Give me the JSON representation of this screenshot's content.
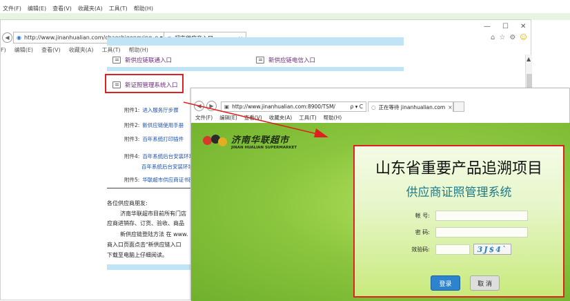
{
  "back_window": {
    "menu": [
      "文件(F)",
      "编辑(E)",
      "查看(V)",
      "收藏夹(A)",
      "工具(T)",
      "帮助(H)"
    ]
  },
  "window1": {
    "url": "http://www.jinanhualian.com/chaoshigongying",
    "addr_controls": "ρ ▾ C",
    "tab_title": "超市供应商入口",
    "tab_close": "×",
    "window_controls": [
      "—",
      "☐",
      "✕"
    ],
    "menu": [
      "F)",
      "编辑(E)",
      "查看(V)",
      "收藏夹(A)",
      "工具(T)",
      "帮助(H)"
    ],
    "links": {
      "unicom": "新供应链联通入口",
      "telecom": "新供应链电信入口",
      "license": "新证照管理系统入口"
    },
    "attachments": [
      {
        "label": "附件1:",
        "text": "进入服务厅步骤"
      },
      {
        "label": "附件2:",
        "text": "新供应链使用手册"
      },
      {
        "label": "附件3:",
        "text": "百年系统打印插件"
      },
      {
        "label": "附件4:",
        "text": "百年系统后台安装环境"
      },
      {
        "label": "",
        "text": "百年系统后台安装环境"
      },
      {
        "label": "附件5:",
        "text": "华联超市供应商证书图"
      }
    ],
    "paragraphs": [
      "各位供应商朋友:",
      "济南华联超市目前所有门店",
      "应商进销存、订货、验收、商品",
      "新供应链登陆方法 在 www.",
      "商入口页面点击\"新供应链入口",
      "下载至电脑上仔细阅读。"
    ]
  },
  "window2": {
    "url": "http://www.jinanhualian.com:8900/TSM/",
    "addr_controls": "ρ ▾ C",
    "tab_title": "正在等待 jinanhualian.com",
    "tab_close": "×",
    "menu": [
      "文件(F)",
      "编辑(E)",
      "查看(V)",
      "收藏夹(A)",
      "工具(T)",
      "帮助(H)"
    ],
    "logo_cn": "济南华联超市",
    "logo_en": "JINAN HUALIAN SUPERMARKET",
    "login": {
      "title": "山东省重要产品追溯项目",
      "subtitle": "供应商证照管理系统",
      "account_label": "帐  号:",
      "password_label": "密  码:",
      "captcha_label": "效验码:",
      "captcha_text": "3J$4`",
      "login_button": "登录",
      "cancel_button": "取 消"
    }
  },
  "colors": {
    "highlight_red": "#e02020",
    "page_green": "#8cc63f",
    "link_band": "#bfe4f5",
    "login_blue": "#2e83cf"
  }
}
